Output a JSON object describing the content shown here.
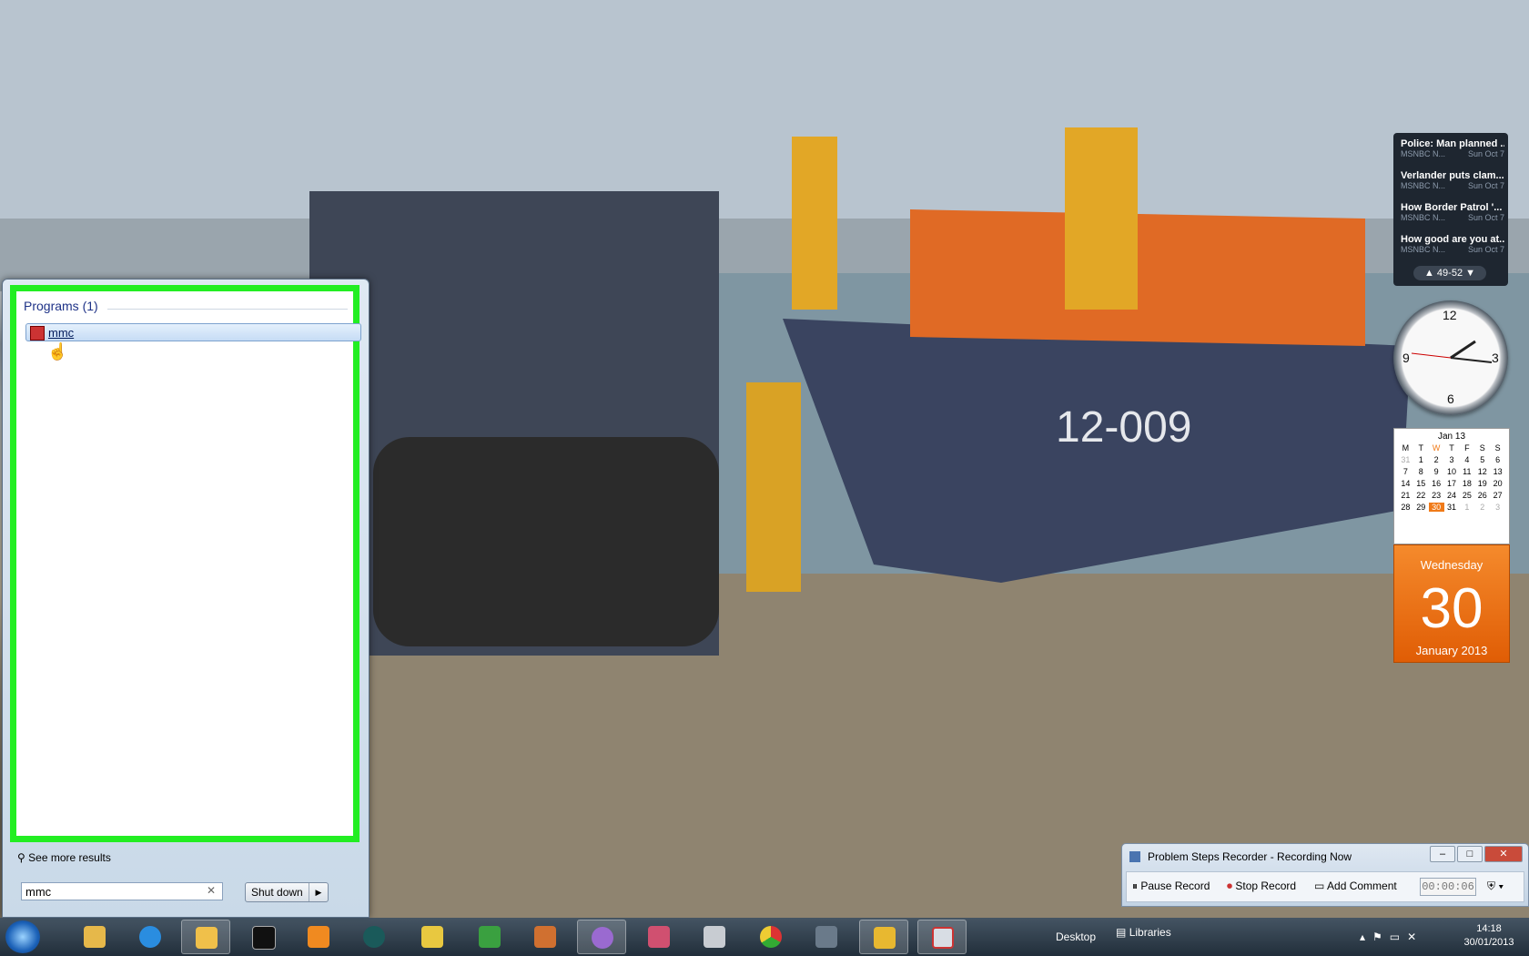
{
  "start_menu": {
    "programs_header": "Programs (1)",
    "result_label": "mmc",
    "see_more": "See more results",
    "search_value": "mmc",
    "shutdown_label": "Shut down"
  },
  "news_gadget": {
    "items": [
      {
        "title": "Police: Man planned ...",
        "source": "MSNBC N...",
        "date": "Sun Oct 7"
      },
      {
        "title": "Verlander puts clam...",
        "source": "MSNBC N...",
        "date": "Sun Oct 7"
      },
      {
        "title": "How Border Patrol '...",
        "source": "MSNBC N...",
        "date": "Sun Oct 7"
      },
      {
        "title": "How good are you at...",
        "source": "MSNBC N...",
        "date": "Sun Oct 7"
      }
    ],
    "range": "49-52"
  },
  "calendar_gadget": {
    "month_label": "Jan 13",
    "weekdays": [
      "M",
      "T",
      "W",
      "T",
      "F",
      "S",
      "S"
    ],
    "days": [
      "31",
      "1",
      "2",
      "3",
      "4",
      "5",
      "6",
      "7",
      "8",
      "9",
      "10",
      "11",
      "12",
      "13",
      "14",
      "15",
      "16",
      "17",
      "18",
      "19",
      "20",
      "21",
      "22",
      "23",
      "24",
      "25",
      "26",
      "27",
      "28",
      "29",
      "30",
      "31",
      "1",
      "2",
      "3"
    ],
    "today": "30",
    "day_name": "Wednesday",
    "day_number": "30",
    "month_year": "January 2013"
  },
  "psr": {
    "title": "Problem Steps Recorder - Recording Now",
    "pause": "Pause Record",
    "stop": "Stop Record",
    "comment": "Add Comment",
    "time": "00:00:06"
  },
  "taskbar": {
    "desktop": "Desktop",
    "libraries": "Libraries",
    "time": "14:18",
    "date": "30/01/2013"
  },
  "colors": {
    "highlight_border": "#22ee22",
    "today": "#f07a18"
  }
}
